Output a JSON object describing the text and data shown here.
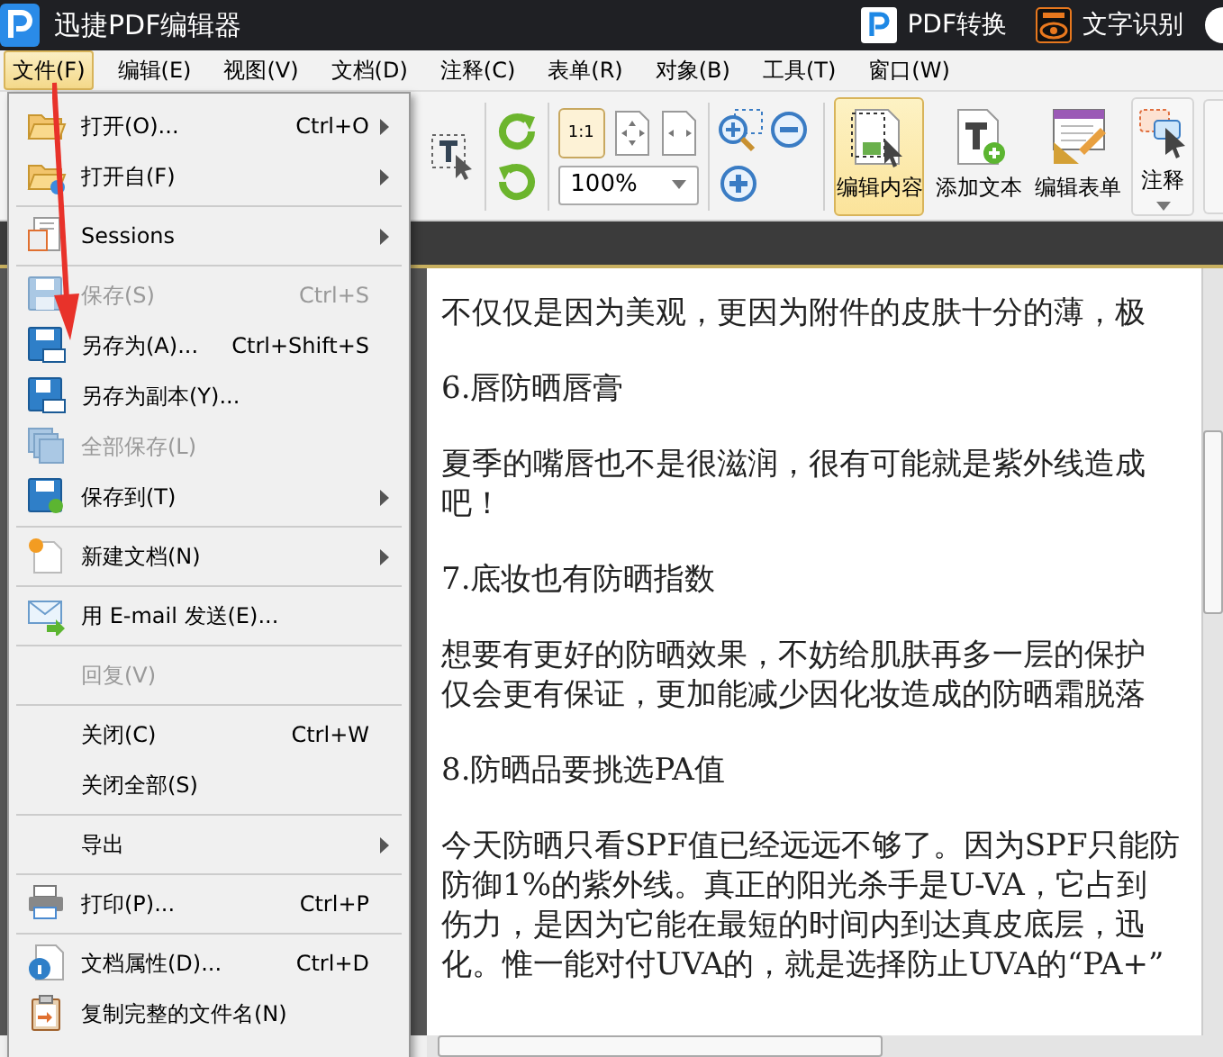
{
  "window": {
    "title": "迅捷PDF编辑器",
    "actions": [
      {
        "label": "PDF转换"
      },
      {
        "label": "文字识别"
      }
    ]
  },
  "menu_bar": [
    {
      "label": "文件(F)",
      "selected": true
    },
    {
      "label": "编辑(E)",
      "selected": false
    },
    {
      "label": "视图(V)",
      "selected": false
    },
    {
      "label": "文档(D)",
      "selected": false
    },
    {
      "label": "注释(C)",
      "selected": false
    },
    {
      "label": "表单(R)",
      "selected": false
    },
    {
      "label": "对象(B)",
      "selected": false
    },
    {
      "label": "工具(T)",
      "selected": false
    },
    {
      "label": "窗口(W)",
      "selected": false
    }
  ],
  "toolbar": {
    "actual_size": "1:1",
    "zoom": {
      "value": "100%"
    },
    "buttons": [
      {
        "kind": "large",
        "label": "编辑内容",
        "selected": true
      },
      {
        "kind": "large",
        "label": "添加文本",
        "selected": false
      },
      {
        "kind": "large",
        "label": "编辑表单",
        "selected": false
      },
      {
        "kind": "dropdown",
        "label": "注释",
        "selected": false
      }
    ]
  },
  "file_menu": [
    {
      "kind": "item",
      "label": "打开(O)...",
      "shortcut": "Ctrl+O",
      "submenu": true,
      "disabled": false
    },
    {
      "kind": "item",
      "label": "打开自(F)",
      "submenu": true,
      "disabled": false
    },
    {
      "kind": "separator"
    },
    {
      "kind": "item",
      "label": "Sessions",
      "submenu": true,
      "disabled": false
    },
    {
      "kind": "separator"
    },
    {
      "kind": "item",
      "label": "保存(S)",
      "shortcut": "Ctrl+S",
      "submenu": false,
      "disabled": true
    },
    {
      "kind": "item",
      "label": "另存为(A)...",
      "shortcut": "Ctrl+Shift+S",
      "submenu": false,
      "disabled": false
    },
    {
      "kind": "item",
      "label": "另存为副本(Y)...",
      "submenu": false,
      "disabled": false
    },
    {
      "kind": "item",
      "label": "全部保存(L)",
      "submenu": false,
      "disabled": true
    },
    {
      "kind": "item",
      "label": "保存到(T)",
      "submenu": true,
      "disabled": false
    },
    {
      "kind": "separator"
    },
    {
      "kind": "item",
      "label": "新建文档(N)",
      "submenu": true,
      "disabled": false
    },
    {
      "kind": "separator"
    },
    {
      "kind": "item",
      "label": "用 E-mail 发送(E)...",
      "submenu": false,
      "disabled": false
    },
    {
      "kind": "separator"
    },
    {
      "kind": "item",
      "label": "回复(V)",
      "submenu": false,
      "disabled": true
    },
    {
      "kind": "separator"
    },
    {
      "kind": "item",
      "label": "关闭(C)",
      "shortcut": "Ctrl+W",
      "submenu": false,
      "disabled": false
    },
    {
      "kind": "item",
      "label": "关闭全部(S)",
      "submenu": false,
      "disabled": false
    },
    {
      "kind": "separator"
    },
    {
      "kind": "item",
      "label": "导出",
      "submenu": true,
      "disabled": false
    },
    {
      "kind": "separator"
    },
    {
      "kind": "item",
      "label": "打印(P)...",
      "shortcut": "Ctrl+P",
      "submenu": false,
      "disabled": false
    },
    {
      "kind": "separator"
    },
    {
      "kind": "item",
      "label": "文档属性(D)...",
      "shortcut": "Ctrl+D",
      "submenu": false,
      "disabled": false
    },
    {
      "kind": "item",
      "label": "复制完整的文件名(N)",
      "submenu": false,
      "disabled": false
    }
  ],
  "document": {
    "paragraphs": [
      [
        "不仅仅是因为美观，更因为附件的皮肤十分的薄，极"
      ],
      [
        "6.唇防晒唇膏"
      ],
      [
        "夏季的嘴唇也不是很滋润，很有可能就是紫外线造成",
        "吧！"
      ],
      [
        "7.底妆也有防晒指数"
      ],
      [
        "想要有更好的防晒效果，不妨给肌肤再多一层的保护",
        "仅会更有保证，更加能减少因化妆造成的防晒霜脱落"
      ],
      [
        "8.防晒品要挑选PA值"
      ],
      [
        "今天防晒只看SPF值已经远远不够了。因为SPF只能防",
        "防御1%的紫外线。真正的阳光杀手是U-VA，它占到",
        "伤力，是因为它能在最短的时间内到达真皮底层，迅",
        "化。惟一能对付UVA的，就是选择防止UVA的“PA+”"
      ]
    ]
  }
}
